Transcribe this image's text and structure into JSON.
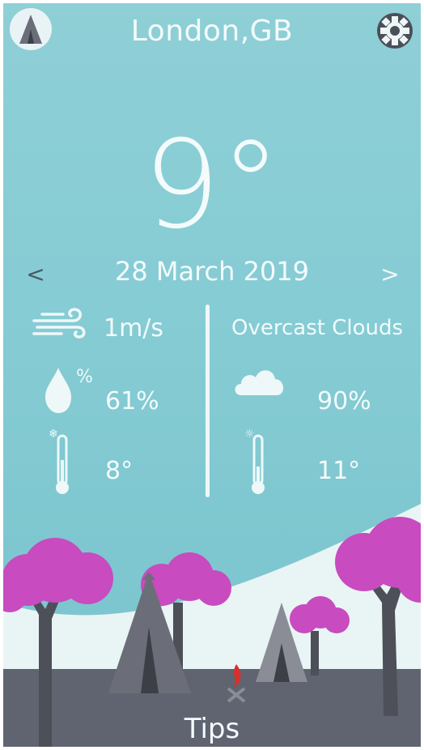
{
  "header": {
    "city": "London,GB",
    "app_icon": "tent-icon",
    "settings_icon": "gear-icon"
  },
  "current": {
    "temperature": "9°",
    "date": "28 March 2019",
    "prev": "<",
    "next": ">"
  },
  "details": {
    "wind": {
      "icon": "wind-icon",
      "value": "1m/s"
    },
    "humidity": {
      "icon": "humidity-drop-icon",
      "value": "61%"
    },
    "temp_min": {
      "icon": "cold-thermometer-icon",
      "value": "8°"
    },
    "description": "Overcast Clouds",
    "clouds": {
      "icon": "cloud-icon",
      "value": "90%"
    },
    "temp_max": {
      "icon": "hot-thermometer-icon",
      "value": "11°"
    }
  },
  "footer": {
    "tips_label": "Tips"
  },
  "colors": {
    "sky": "#86ccd4",
    "text": "#f3fbfc",
    "tree_pink": "#c84bbf",
    "ground": "#5f6470",
    "snow": "#e9f4f5"
  }
}
